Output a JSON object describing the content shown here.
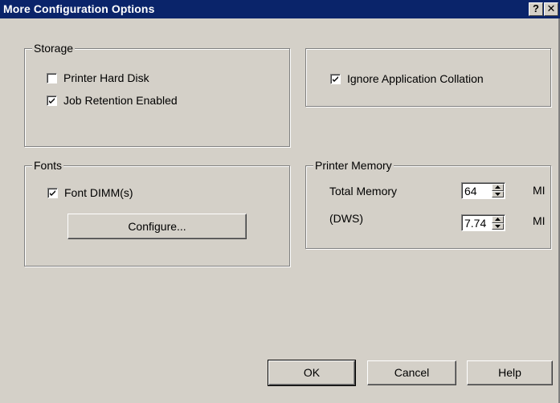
{
  "window": {
    "title": "More Configuration Options",
    "help_glyph": "?",
    "close_glyph": "✕"
  },
  "storage": {
    "legend": "Storage",
    "printer_hard_disk": {
      "label": "Printer Hard Disk",
      "checked": false
    },
    "job_retention": {
      "label": "Job Retention Enabled",
      "checked": true
    }
  },
  "collation": {
    "label": "Ignore Application Collation",
    "checked": true
  },
  "fonts": {
    "legend": "Fonts",
    "font_dimm": {
      "label": "Font DIMM(s)",
      "checked": true
    },
    "configure_label": "Configure..."
  },
  "memory": {
    "legend": "Printer Memory",
    "total_label": "Total Memory",
    "total_value": "64",
    "total_unit": "MI",
    "dws_label": "(DWS)",
    "dws_value": "7.74",
    "dws_unit": "MI"
  },
  "buttons": {
    "ok": "OK",
    "cancel": "Cancel",
    "help": "Help"
  },
  "colors": {
    "face": "#d4d0c8",
    "title_bar": "#0a246a",
    "shadow": "#808080",
    "highlight": "#ffffff"
  }
}
